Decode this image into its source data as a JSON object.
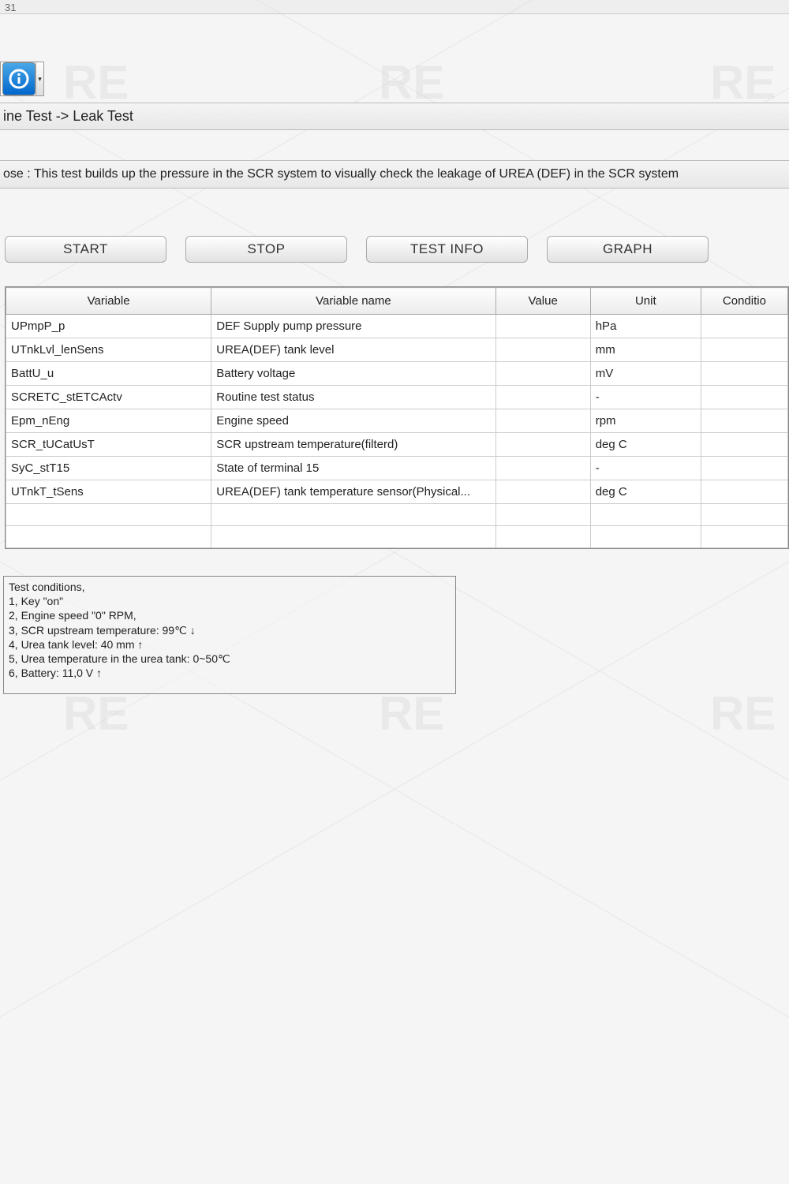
{
  "header": {
    "top_number": "31"
  },
  "breadcrumb": "ine Test -> Leak Test",
  "purpose_text": "ose : This test builds up the pressure in the SCR system to visually check the leakage of UREA (DEF) in the SCR system",
  "buttons": {
    "start": "START",
    "stop": "STOP",
    "test_info": "TEST INFO",
    "graph": "GRAPH"
  },
  "table": {
    "headers": {
      "variable": "Variable",
      "variable_name": "Variable name",
      "value": "Value",
      "unit": "Unit",
      "condition": "Conditio"
    },
    "rows": [
      {
        "variable": "UPmpP_p",
        "name": "DEF Supply pump pressure",
        "value": "",
        "unit": "hPa",
        "cond": ""
      },
      {
        "variable": "UTnkLvl_lenSens",
        "name": "UREA(DEF) tank level",
        "value": "",
        "unit": "mm",
        "cond": ""
      },
      {
        "variable": "BattU_u",
        "name": "Battery voltage",
        "value": "",
        "unit": "mV",
        "cond": ""
      },
      {
        "variable": "SCRETC_stETCActv",
        "name": "Routine test status",
        "value": "",
        "unit": "-",
        "cond": ""
      },
      {
        "variable": "Epm_nEng",
        "name": "Engine speed",
        "value": "",
        "unit": "rpm",
        "cond": ""
      },
      {
        "variable": "SCR_tUCatUsT",
        "name": "SCR upstream temperature(filterd)",
        "value": "",
        "unit": "deg C",
        "cond": ""
      },
      {
        "variable": "SyC_stT15",
        "name": "State of terminal 15",
        "value": "",
        "unit": "-",
        "cond": ""
      },
      {
        "variable": "UTnkT_tSens",
        "name": "UREA(DEF) tank temperature sensor(Physical...",
        "value": "",
        "unit": "deg C",
        "cond": ""
      },
      {
        "variable": "",
        "name": "",
        "value": "",
        "unit": "",
        "cond": ""
      },
      {
        "variable": "",
        "name": "",
        "value": "",
        "unit": "",
        "cond": ""
      }
    ]
  },
  "conditions_text": "Test conditions,\n1, Key \"on\"\n2, Engine speed \"0\" RPM,\n3, SCR upstream temperature: 99℃ ↓\n4, Urea tank level: 40 mm ↑\n5, Urea temperature in the urea tank: 0~50℃\n6, Battery: 11,0 V ↑"
}
